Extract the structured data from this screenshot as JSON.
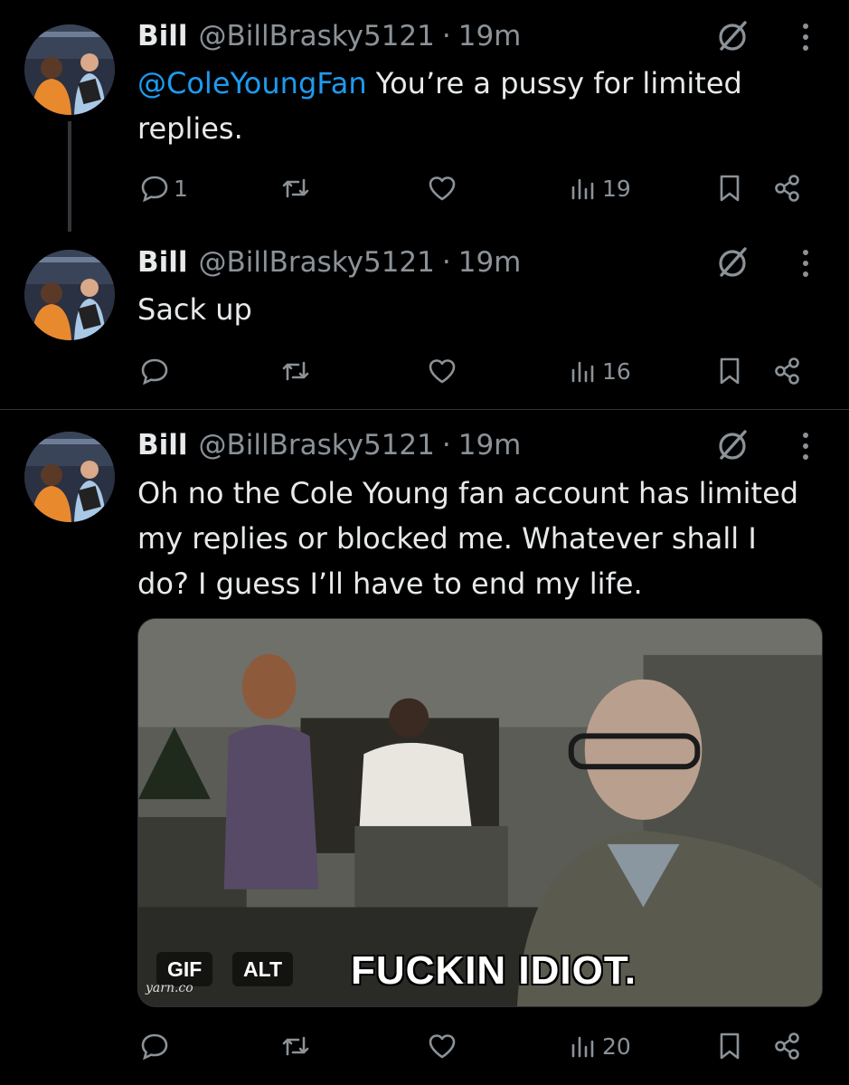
{
  "tweets": [
    {
      "name": "Bill",
      "handle": "@BillBrasky5121",
      "separator": "·",
      "time": "19m",
      "mention": "@ColeYoungFan",
      "text": " You’re a pussy for limited replies.",
      "replies": "1",
      "views": "19"
    },
    {
      "name": "Bill",
      "handle": "@BillBrasky5121",
      "separator": "·",
      "time": "19m",
      "text": "Sack up",
      "views": "16"
    },
    {
      "name": "Bill",
      "handle": "@BillBrasky5121",
      "separator": "·",
      "time": "19m",
      "text": "Oh no the Cole Young fan account has limited my replies or blocked me. Whatever shall I do? I guess I’ll have to end my life.",
      "views": "20",
      "media": {
        "gif_label": "GIF",
        "alt_label": "ALT",
        "caption": "FUCKIN IDIOT.",
        "watermark": "yarn.co"
      }
    }
  ],
  "icons": {
    "reply": "reply-icon",
    "retweet": "retweet-icon",
    "like": "heart-icon",
    "views": "views-icon",
    "bookmark": "bookmark-icon",
    "share": "share-icon",
    "grok": "grok-icon",
    "more": "more-options-icon"
  },
  "colors": {
    "background": "#000000",
    "text": "#e7e9ea",
    "secondary": "#8b9298",
    "accent": "#1d9bf0",
    "divider": "#2f3336"
  }
}
